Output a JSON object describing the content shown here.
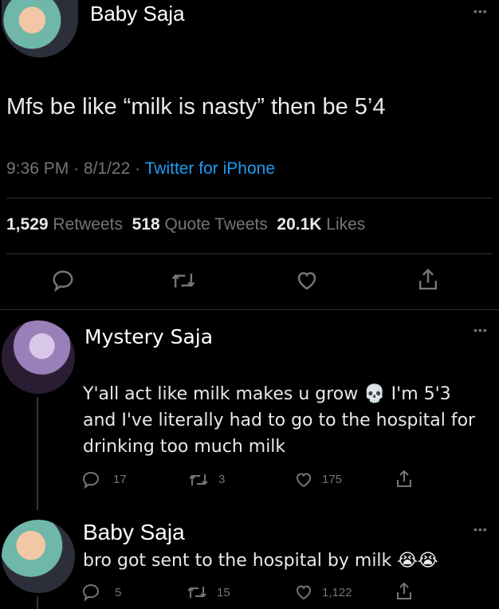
{
  "main_tweet": {
    "display_name": "Baby Saja",
    "text": "Mfs be like “milk is nasty” then be 5’4",
    "time": "9:36 PM",
    "date": "8/1/22",
    "separator": "·",
    "source": "Twitter for iPhone",
    "stats": [
      {
        "count": "1,529",
        "label": "Retweets"
      },
      {
        "count": "518",
        "label": "Quote Tweets"
      },
      {
        "count": "20.1K",
        "label": "Likes"
      }
    ]
  },
  "replies": [
    {
      "display_name": "Mystery Saja",
      "text_line1": "Y'all act like milk makes u grow",
      "emoji1": "💀",
      "text_line1b": "I'm 5'3",
      "text_line2": "and I've literally had to go to the hospital for",
      "text_line3": "drinking too much milk",
      "reply_count": "17",
      "retweet_count": "3",
      "like_count": "175"
    },
    {
      "display_name": "Baby Saja",
      "text": "bro got sent to the hospital by milk",
      "emoji": "😭😭",
      "reply_count": "5",
      "retweet_count": "15",
      "like_count": "1,122"
    }
  ],
  "more_glyph": "•••",
  "icons": [
    "reply-icon",
    "retweet-icon",
    "like-icon",
    "share-icon",
    "more-icon",
    "skull-emoji",
    "crying-emoji"
  ]
}
